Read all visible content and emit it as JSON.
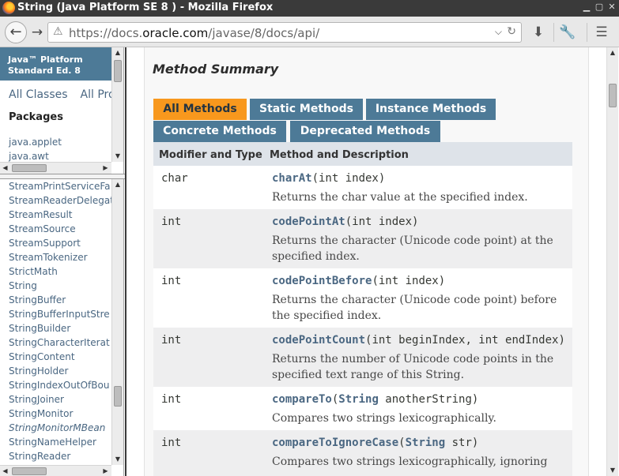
{
  "window": {
    "title": "String (Java Platform SE 8 ) - Mozilla Firefox",
    "controls": [
      "minimize-icon",
      "maximize-icon",
      "close-icon"
    ]
  },
  "toolbar": {
    "url_prefix": "https://docs.",
    "url_host": "oracle.com",
    "url_path": "/javase/8/docs/api/",
    "icons": [
      "back-arrow-icon",
      "forward-arrow-icon",
      "warning-icon",
      "dropdown-icon",
      "reload-icon",
      "download-icon",
      "wrench-icon",
      "menu-icon"
    ]
  },
  "left_top": {
    "platform_title_line1": "Java™ Platform",
    "platform_title_line2": "Standard Ed. 8",
    "all_classes": "All Classes",
    "all_profiles": "All Pro",
    "packages_heading": "Packages",
    "packages": [
      "java.applet",
      "java.awt"
    ]
  },
  "left_bottom": {
    "classes": [
      {
        "name": "StreamPrintServiceFa",
        "italic": false
      },
      {
        "name": "StreamReaderDelegat",
        "italic": false
      },
      {
        "name": "StreamResult",
        "italic": false
      },
      {
        "name": "StreamSource",
        "italic": false
      },
      {
        "name": "StreamSupport",
        "italic": false
      },
      {
        "name": "StreamTokenizer",
        "italic": false
      },
      {
        "name": "StrictMath",
        "italic": false
      },
      {
        "name": "String",
        "italic": false
      },
      {
        "name": "StringBuffer",
        "italic": false
      },
      {
        "name": "StringBufferInputStre",
        "italic": false
      },
      {
        "name": "StringBuilder",
        "italic": false
      },
      {
        "name": "StringCharacterIterat",
        "italic": false
      },
      {
        "name": "StringContent",
        "italic": false
      },
      {
        "name": "StringHolder",
        "italic": false
      },
      {
        "name": "StringIndexOutOfBou",
        "italic": false
      },
      {
        "name": "StringJoiner",
        "italic": false
      },
      {
        "name": "StringMonitor",
        "italic": false
      },
      {
        "name": "StringMonitorMBean",
        "italic": true
      },
      {
        "name": "StringNameHelper",
        "italic": false
      },
      {
        "name": "StringReader",
        "italic": false
      }
    ]
  },
  "main": {
    "section_title": "Method Summary",
    "tabs": [
      "All Methods",
      "Static Methods",
      "Instance Methods",
      "Concrete Methods",
      "Deprecated Methods"
    ],
    "active_tab": "All Methods",
    "columns": [
      "Modifier and Type",
      "Method and Description"
    ],
    "methods": [
      {
        "type": "char",
        "name": "charAt",
        "params_pre": "(int index)",
        "params_type": "",
        "params_post": "",
        "desc1": "Returns the char value at the specified index.",
        "desc2": ""
      },
      {
        "type": "int",
        "name": "codePointAt",
        "params_pre": "(int index)",
        "params_type": "",
        "params_post": "",
        "desc1": "Returns the character (Unicode code point) at the",
        "desc2": "specified index."
      },
      {
        "type": "int",
        "name": "codePointBefore",
        "params_pre": "(int index)",
        "params_type": "",
        "params_post": "",
        "desc1": "Returns the character (Unicode code point) before",
        "desc2": "the specified index."
      },
      {
        "type": "int",
        "name": "codePointCount",
        "params_pre": "(int beginIndex, int endIndex)",
        "params_type": "",
        "params_post": "",
        "desc1": "Returns the number of Unicode code points in the",
        "desc2": "specified text range of this String."
      },
      {
        "type": "int",
        "name": "compareTo",
        "params_pre": "(",
        "params_type": "String",
        "params_post": " anotherString)",
        "desc1": "Compares two strings lexicographically.",
        "desc2": ""
      },
      {
        "type": "int",
        "name": "compareToIgnoreCase",
        "params_pre": "(",
        "params_type": "String",
        "params_post": " str)",
        "desc1": "Compares two strings lexicographically, ignoring",
        "desc2": ""
      }
    ]
  }
}
